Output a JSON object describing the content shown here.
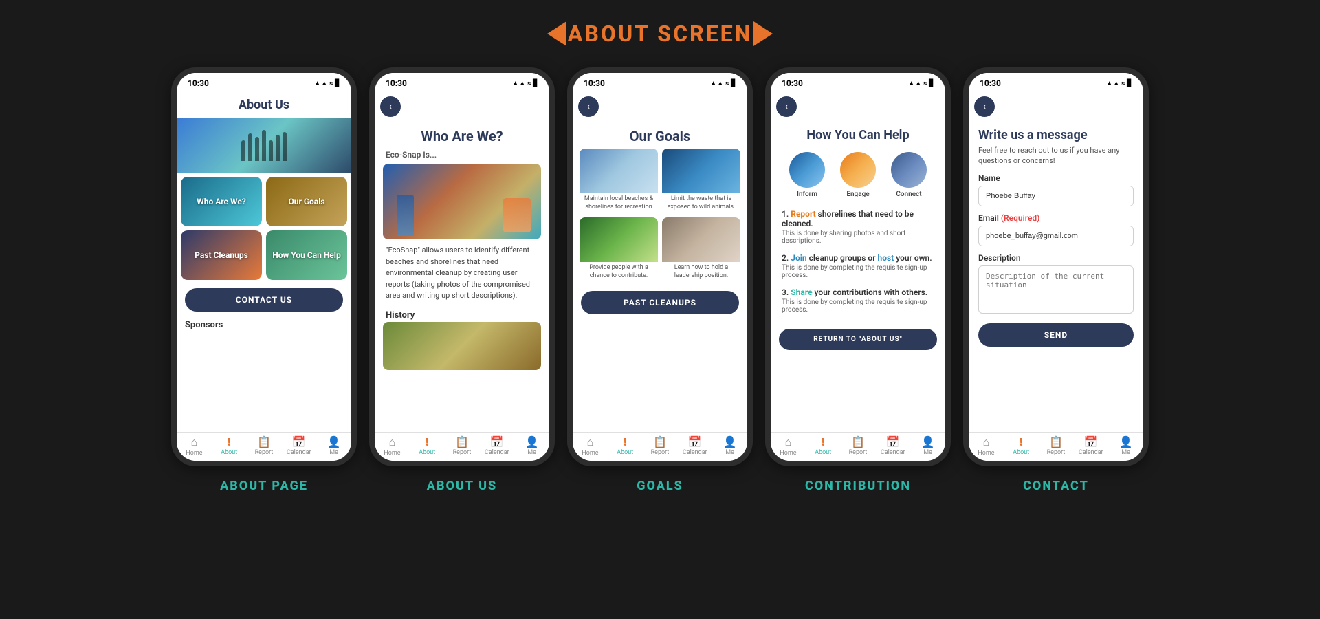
{
  "header": {
    "title": "ABOUT SCREEN"
  },
  "phones": [
    {
      "id": "about-page",
      "label": "ABOUT PAGE",
      "status_time": "10:30",
      "screen": {
        "title": "About Us",
        "tiles": [
          {
            "label": "Who Are We?",
            "style": "tile-ocean"
          },
          {
            "label": "Our Goals",
            "style": "tile-earth"
          },
          {
            "label": "Past Cleanups",
            "style": "tile-sunset"
          },
          {
            "label": "How You Can Help",
            "style": "tile-map"
          }
        ],
        "contact_btn": "CONTACT US",
        "sponsors_label": "Sponsors"
      }
    },
    {
      "id": "about-us",
      "label": "ABOUT US",
      "status_time": "10:30",
      "screen": {
        "title": "Who Are We?",
        "subtitle": "Eco-Snap Is...",
        "description": "\"EcoSnap\" allows users to identify different beaches and shorelines that need environmental cleanup by creating user reports (taking photos of the compromised area and writing up short descriptions).",
        "history_label": "History"
      }
    },
    {
      "id": "goals",
      "label": "GOALS",
      "status_time": "10:30",
      "screen": {
        "title": "Our Goals",
        "goal_cards": [
          {
            "caption": "Maintain local beaches & shorelines for recreation",
            "img": "goal-img-beach"
          },
          {
            "caption": "Limit the waste that is exposed to wild animals.",
            "img": "goal-img-whale"
          },
          {
            "caption": "Provide people with a chance to contribute.",
            "img": "goal-img-hands"
          },
          {
            "caption": "Learn how to hold a leadership position.",
            "img": "goal-img-office"
          }
        ],
        "past_cleanups_btn": "PAST CLEANUPS"
      }
    },
    {
      "id": "contribution",
      "label": "CONTRIBUTION",
      "status_time": "10:30",
      "screen": {
        "title": "How You Can Help",
        "icons": [
          {
            "label": "Inform",
            "style": "circle-inform"
          },
          {
            "label": "Engage",
            "style": "circle-engage"
          },
          {
            "label": "Connect",
            "style": "circle-connect"
          }
        ],
        "steps": [
          {
            "num": "1.",
            "action": "Report",
            "action_style": "orange",
            "rest": " shorelines that need to be cleaned.",
            "desc": "This is done by sharing photos and short descriptions."
          },
          {
            "num": "2.",
            "action": "Join",
            "action_style": "blue",
            "rest": " cleanup groups or ",
            "action2": "host",
            "rest2": " your own.",
            "desc": "This is done by completing the requisite sign-up process."
          },
          {
            "num": "3.",
            "action": "Share",
            "action_style": "teal",
            "rest": " your contributions with others.",
            "desc": "This is done by completing the requisite sign-up process."
          }
        ],
        "return_btn": "RETURN TO \"ABOUT US\""
      }
    },
    {
      "id": "contact",
      "label": "CONTACT",
      "status_time": "10:30",
      "screen": {
        "title": "Write us a message",
        "subtitle": "Feel free to reach out to us if you have any questions or concerns!",
        "name_label": "Name",
        "name_value": "Phoebe Buffay",
        "email_label": "Email",
        "email_required": "(Required)",
        "email_value": "phoebe_buffay@gmail.com",
        "desc_label": "Description",
        "desc_placeholder": "Description of the current situation",
        "send_btn": "SEND"
      }
    }
  ],
  "nav_items": [
    {
      "label": "Home",
      "icon": "🏠"
    },
    {
      "label": "About",
      "icon": "!"
    },
    {
      "label": "Report",
      "icon": "📋"
    },
    {
      "label": "Calendar",
      "icon": "📅"
    },
    {
      "label": "Me",
      "icon": "👤"
    }
  ]
}
